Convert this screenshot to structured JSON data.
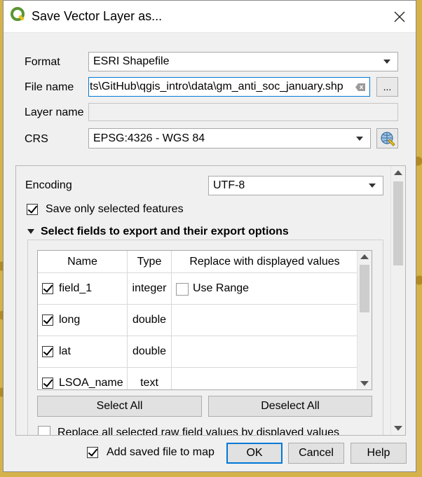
{
  "dialog": {
    "title": "Save Vector Layer as...",
    "close_label": "✕"
  },
  "form": {
    "format_label": "Format",
    "format_value": "ESRI Shapefile",
    "filename_label": "File name",
    "filename_value": "ts\\GitHub\\qgis_intro\\data\\gm_anti_soc_january.shp",
    "browse_label": "...",
    "layername_label": "Layer name",
    "layername_value": "",
    "crs_label": "CRS",
    "crs_value": "EPSG:4326 - WGS 84"
  },
  "options": {
    "encoding_label": "Encoding",
    "encoding_value": "UTF-8",
    "save_selected_label": "Save only selected features",
    "save_selected_checked": true,
    "fields_section_label": "Select fields to export and their export options",
    "table_headers": [
      "Name",
      "Type",
      "Replace with displayed values"
    ],
    "rows": [
      {
        "checked": true,
        "name": "field_1",
        "type": "integer",
        "replace": "Use Range",
        "has_replace_checkbox": true
      },
      {
        "checked": true,
        "name": "long",
        "type": "double",
        "replace": ""
      },
      {
        "checked": true,
        "name": "lat",
        "type": "double",
        "replace": ""
      },
      {
        "checked": true,
        "name": "LSOA_name",
        "type": "text",
        "replace": ""
      }
    ],
    "select_all_label": "Select All",
    "deselect_all_label": "Deselect All",
    "replace_all_label": "Replace all selected raw field values by displayed values"
  },
  "footer": {
    "add_to_map_label": "Add saved file to map",
    "add_to_map_checked": true,
    "ok_label": "OK",
    "cancel_label": "Cancel",
    "help_label": "Help"
  },
  "colors": {
    "qgis_green": "#589632",
    "qgis_yellow": "#f0c419",
    "default_button_border": "#0078d7"
  }
}
